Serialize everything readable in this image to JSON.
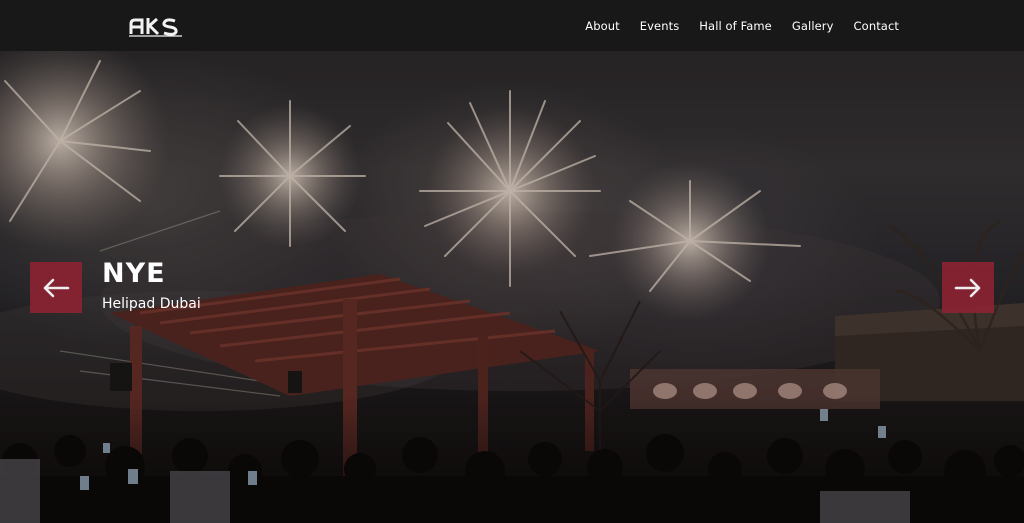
{
  "nav": {
    "logo_text": "AKS",
    "links": [
      "About",
      "Events",
      "Hall of Fame",
      "Gallery",
      "Contact"
    ]
  },
  "hero": {
    "title": "NYE",
    "subtitle": "Helipad Dubai",
    "prev_icon": "arrow-left-icon",
    "next_icon": "arrow-right-icon"
  },
  "colors": {
    "nav_bg": "#181818",
    "accent": "#8b2232",
    "text": "#ffffff"
  }
}
